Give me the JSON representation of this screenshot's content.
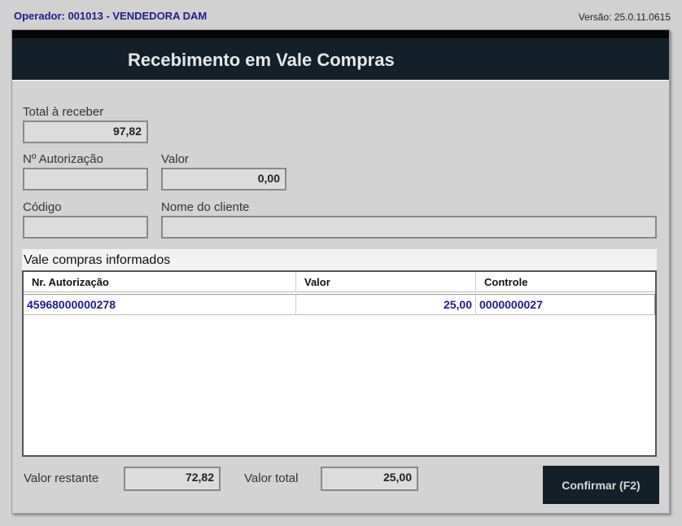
{
  "header": {
    "operator": "Operador: 001013 - VENDEDORA DAM",
    "version": "Versão: 25.0.11.0615"
  },
  "dialog": {
    "title": "Recebimento em Vale Compras"
  },
  "form": {
    "total_label": "Total à receber",
    "total_value": "97,82",
    "auth_label": "Nº Autorização",
    "auth_value": "",
    "valor_label": "Valor",
    "valor_value": "0,00",
    "codigo_label": "Código",
    "codigo_value": "",
    "nome_label": "Nome do cliente",
    "nome_value": ""
  },
  "table": {
    "title": "Vale compras informados",
    "columns": [
      "Nr. Autorização",
      "Valor",
      "Controle"
    ],
    "rows": [
      [
        "45968000000278",
        "25,00",
        "0000000027"
      ]
    ]
  },
  "footer": {
    "restante_label": "Valor restante",
    "restante_value": "72,82",
    "total_label": "Valor total",
    "total_value": "25,00",
    "confirm_label": "Confirmar (F2)"
  }
}
